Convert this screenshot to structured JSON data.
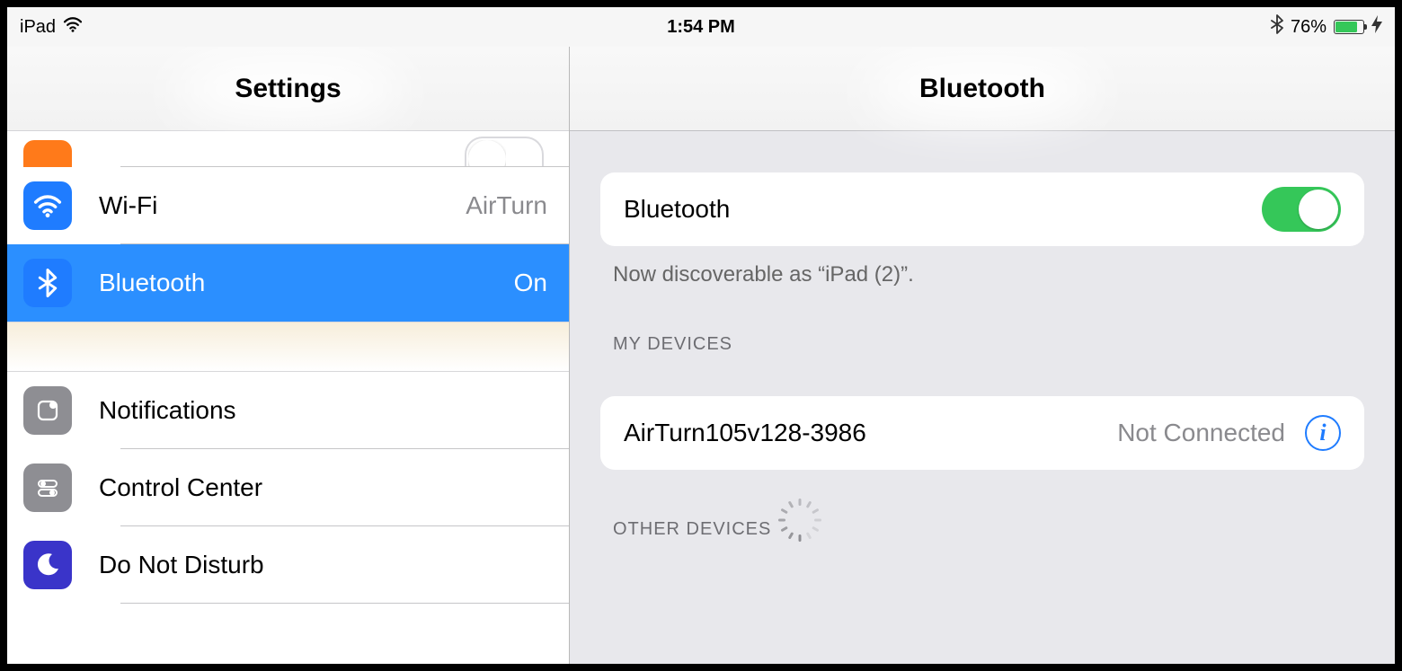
{
  "status": {
    "carrier": "iPad",
    "time": "1:54 PM",
    "battery_pct": "76%"
  },
  "master": {
    "title": "Settings",
    "rows": {
      "wifi": {
        "label": "Wi-Fi",
        "value": "AirTurn"
      },
      "bluetooth": {
        "label": "Bluetooth",
        "value": "On"
      },
      "notifications": {
        "label": "Notifications"
      },
      "controlcenter": {
        "label": "Control Center"
      },
      "dnd": {
        "label": "Do Not Disturb"
      }
    }
  },
  "detail": {
    "title": "Bluetooth",
    "toggle_label": "Bluetooth",
    "toggle_on": true,
    "discoverable_text": "Now discoverable as “iPad (2)”.",
    "section_my_devices": "MY DEVICES",
    "my_devices": [
      {
        "name": "AirTurn105v128-3986",
        "status": "Not Connected"
      }
    ],
    "section_other_devices": "OTHER DEVICES"
  }
}
